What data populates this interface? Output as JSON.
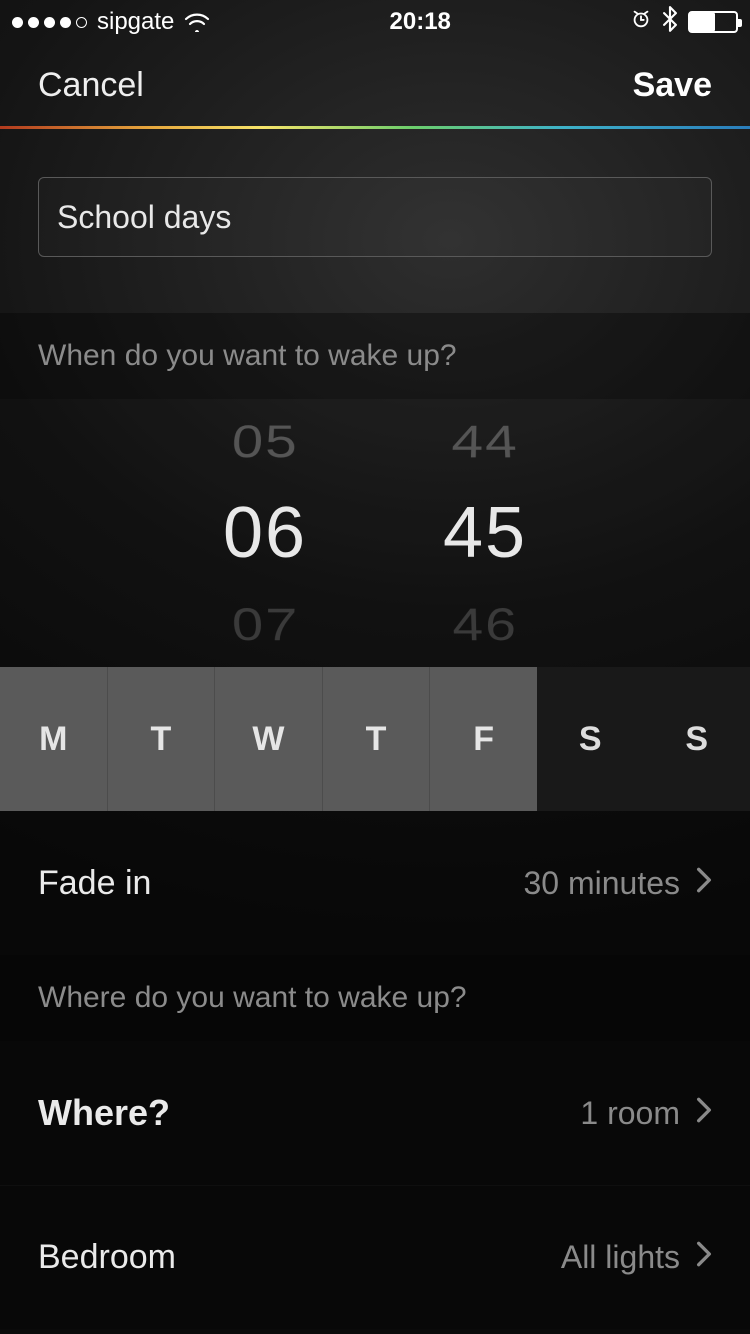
{
  "status": {
    "carrier": "sipgate",
    "time": "20:18",
    "signal_filled": 4,
    "signal_total": 5
  },
  "nav": {
    "cancel": "Cancel",
    "save": "Save"
  },
  "routine": {
    "name": "School days"
  },
  "sections": {
    "when_header": "When do you want to wake up?",
    "where_header": "Where do you want to wake up?"
  },
  "time_picker": {
    "hour_prev": "05",
    "hour": "06",
    "hour_next": "07",
    "minute_prev": "44",
    "minute": "45",
    "minute_next": "46"
  },
  "days": [
    {
      "label": "M",
      "selected": true
    },
    {
      "label": "T",
      "selected": true
    },
    {
      "label": "W",
      "selected": true
    },
    {
      "label": "T",
      "selected": true
    },
    {
      "label": "F",
      "selected": true
    },
    {
      "label": "S",
      "selected": false
    },
    {
      "label": "S",
      "selected": false
    }
  ],
  "fade": {
    "label": "Fade in",
    "value": "30 minutes"
  },
  "where": {
    "label": "Where?",
    "value": "1 room"
  },
  "room": {
    "label": "Bedroom",
    "value": "All lights"
  }
}
